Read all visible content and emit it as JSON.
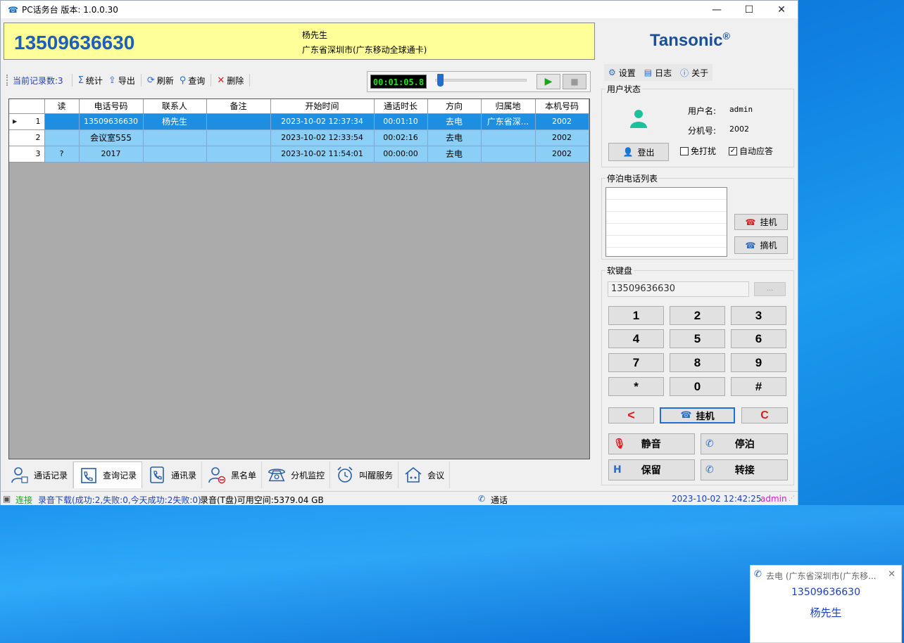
{
  "window": {
    "title": "PC话务台  版本: 1.0.0.30",
    "minimize": "—",
    "maximize": "☐",
    "close": "✕"
  },
  "caller": {
    "number": "13509636630",
    "name": "杨先生",
    "location": "广东省深圳市(广东移动全球通卡)"
  },
  "toolbar": {
    "record_count": "当前记录数:3",
    "buttons": [
      {
        "label": "统计",
        "icon": "sigma-icon"
      },
      {
        "label": "导出",
        "icon": "export-icon"
      },
      {
        "label": "刷新",
        "icon": "refresh-icon"
      },
      {
        "label": "查询",
        "icon": "search-icon"
      },
      {
        "label": "删除",
        "icon": "delete-icon"
      }
    ]
  },
  "player": {
    "time": "00:01:05.8",
    "progress_fraction": 0.02
  },
  "table": {
    "columns": [
      "读",
      "电话号码",
      "联系人",
      "备注",
      "开始时间",
      "通话时长",
      "方向",
      "归属地",
      "本机号码"
    ],
    "rows": [
      {
        "no": "1",
        "read": "",
        "phone": "13509636630",
        "contact": "杨先生",
        "note": "",
        "start": "2023-10-02 12:37:34",
        "duration": "00:01:10",
        "dir": "去电",
        "loc": "广东省深...",
        "ext": "2002"
      },
      {
        "no": "2",
        "read": "",
        "phone": "会议室555",
        "contact": "",
        "note": "",
        "start": "2023-10-02 12:33:54",
        "duration": "00:02:16",
        "dir": "去电",
        "loc": "",
        "ext": "2002"
      },
      {
        "no": "3",
        "read": "?",
        "phone": "2017",
        "contact": "",
        "note": "",
        "start": "2023-10-02 11:54:01",
        "duration": "00:00:00",
        "dir": "去电",
        "loc": "",
        "ext": "2002"
      }
    ]
  },
  "tabs": [
    "通话记录",
    "查询记录",
    "通讯录",
    "黑名单",
    "分机监控",
    "叫醒服务",
    "会议"
  ],
  "status": {
    "connection": "连接",
    "download": "录音下载(成功:2,失败:0,今天成功:2失败:0)",
    "space": "录音(T盘)可用空间:5379.04 GB",
    "call_state": "通话",
    "datetime": "2023-10-02 12:42:25",
    "user": "admin"
  },
  "right": {
    "logo": "Tansonic",
    "logo_mark": "®",
    "menu": [
      "设置",
      "日志",
      "关于"
    ],
    "user_status_title": "用户状态",
    "username_label": "用户名:",
    "username": "admin",
    "ext_label": "分机号:",
    "ext": "2002",
    "logout": "登出",
    "dnd": "免打扰",
    "auto_answer": "自动应答",
    "dnd_checked": false,
    "auto_answer_checked": true,
    "park_title": "停泊电话列表",
    "hangup": "挂机",
    "pickup": "摘机",
    "keypad_title": "软键盘",
    "dial_value": "13509636630",
    "dial_extra": "...",
    "keys": [
      "1",
      "2",
      "3",
      "4",
      "5",
      "6",
      "7",
      "8",
      "9",
      "*",
      "0",
      "#"
    ],
    "back": "<",
    "main_hangup": "挂机",
    "clear": "C",
    "mute": "静音",
    "park": "停泊",
    "hold": "保留",
    "transfer": "转接"
  },
  "popup": {
    "title": "去电 (广东省深圳市(广东移...",
    "number": "13509636630",
    "name": "杨先生"
  },
  "colors": {
    "selected_row": "#1e8fe0",
    "row": "#8ccff6",
    "caller_bg": "#ffff99",
    "number_blue": "#1c5fbf"
  }
}
